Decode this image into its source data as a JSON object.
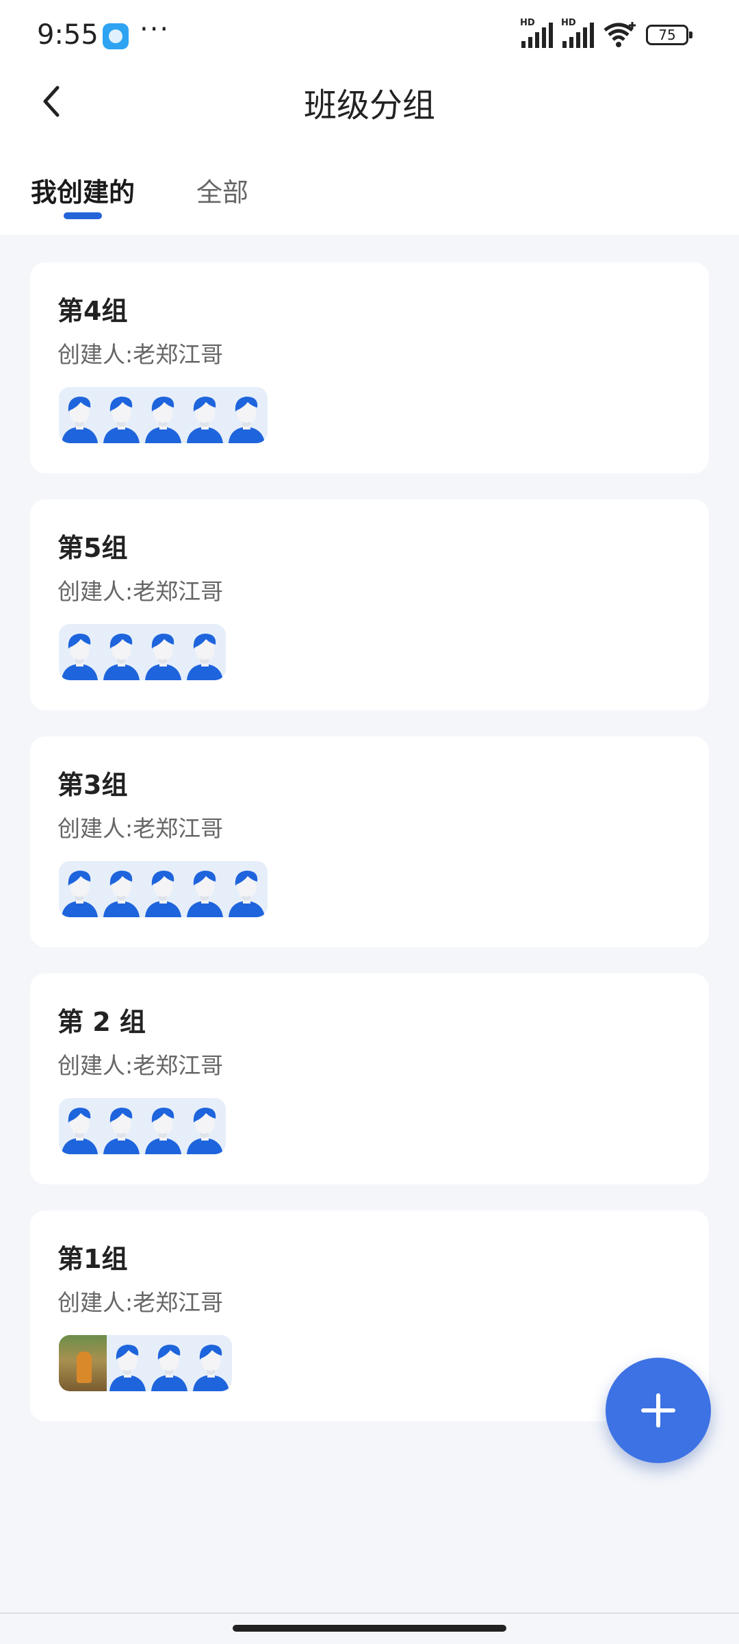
{
  "status_bar": {
    "time": "9:55",
    "more": "···",
    "signal_label_1": "HD",
    "signal_label_2": "HD",
    "battery": "75"
  },
  "nav": {
    "title": "班级分组"
  },
  "tabs": [
    {
      "label": "我创建的",
      "active": true
    },
    {
      "label": "全部",
      "active": false
    }
  ],
  "groups": [
    {
      "name": "第4组",
      "creator": "创建人:老郑江哥",
      "member_count": 5
    },
    {
      "name": "第5组",
      "creator": "创建人:老郑江哥",
      "member_count": 4
    },
    {
      "name": "第3组",
      "creator": "创建人:老郑江哥",
      "member_count": 5
    },
    {
      "name": "第 2 组",
      "creator": "创建人:老郑江哥",
      "member_count": 4
    },
    {
      "name": "第1组",
      "creator": "创建人:老郑江哥",
      "member_count": 4,
      "first_avatar": "photo"
    }
  ],
  "colors": {
    "accent": "#3d72e4",
    "avatar": "#1e64dc",
    "background": "#f4f6fa"
  },
  "icons": {
    "back": "chevron-left-icon",
    "fab": "plus-icon"
  }
}
